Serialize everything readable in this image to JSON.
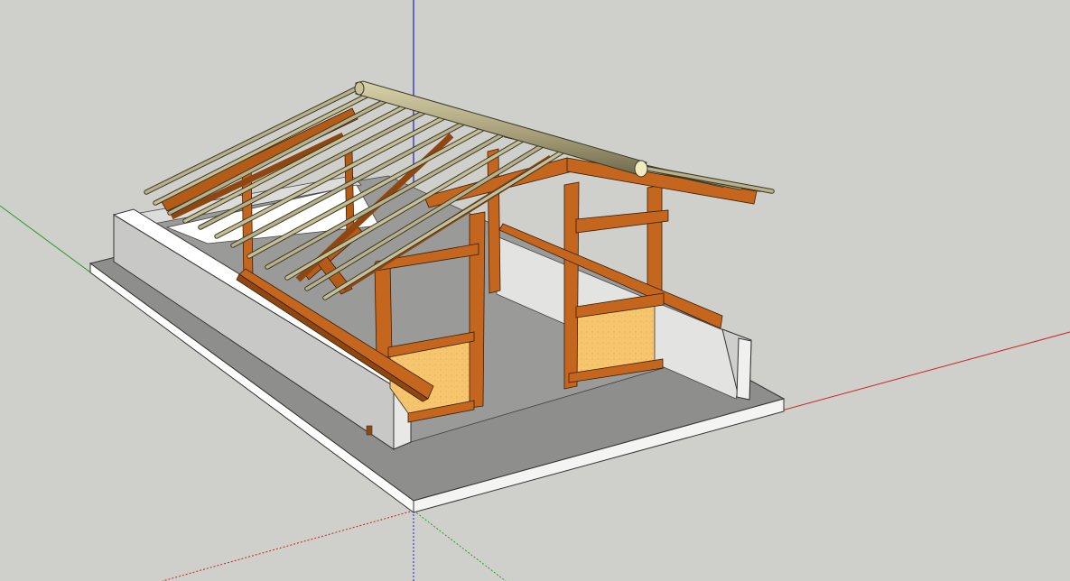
{
  "app": {
    "view": "3d-modeling-viewport",
    "background_color": "#cfcfcb"
  },
  "axes": {
    "x_color": "#d22020",
    "y_color": "#22a022",
    "z_color": "#2020c8"
  },
  "model": {
    "name": "",
    "materials": {
      "concrete_top": "#8e8e8c",
      "concrete_side": "#c8c8c6",
      "slab_edge": "#ffffff",
      "timber": "#c4661e",
      "timber_dark": "#8f4712",
      "bamboo": "#b7b08a",
      "bamboo_dark": "#8a8562",
      "infill_panel": "#f5c66d"
    }
  }
}
